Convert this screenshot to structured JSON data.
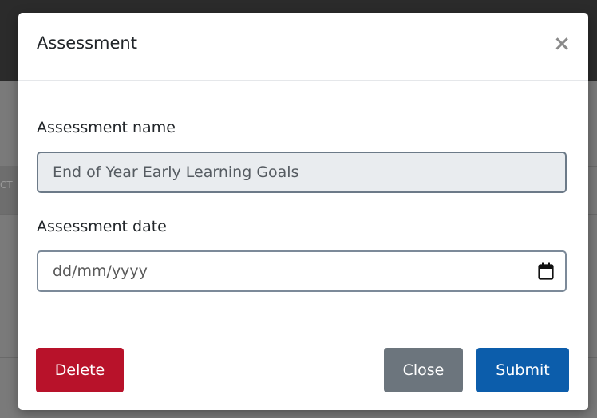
{
  "background": {
    "stub_text": "CT"
  },
  "modal": {
    "title": "Assessment",
    "close_icon": "×",
    "assessment_name": {
      "label": "Assessment name",
      "value": "End of Year Early Learning Goals"
    },
    "assessment_date": {
      "label": "Assessment date",
      "placeholder": "dd/mm/yyyy",
      "icon": "calendar-icon"
    },
    "footer": {
      "delete_label": "Delete",
      "close_label": "Close",
      "submit_label": "Submit"
    }
  },
  "colors": {
    "delete": "#b8122a",
    "close": "#6c757d",
    "submit": "#0c5dab",
    "readonly_bg": "#e9ecef"
  }
}
